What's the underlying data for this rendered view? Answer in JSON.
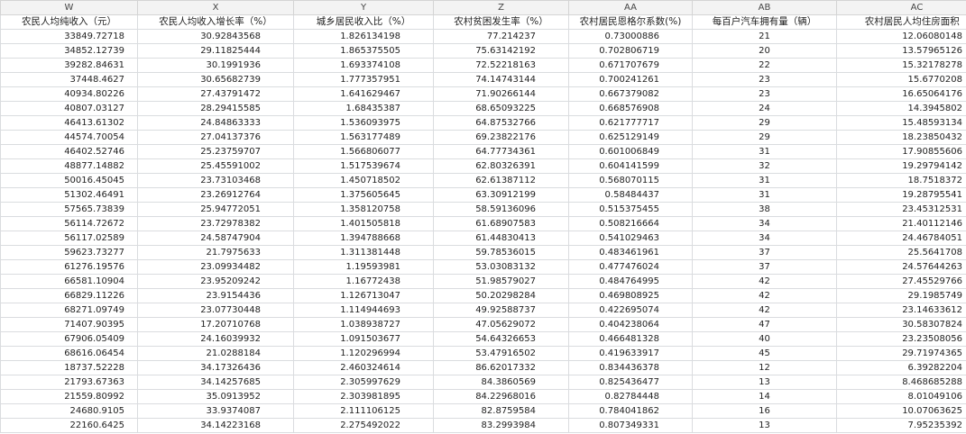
{
  "sheet": {
    "column_letters": [
      "W",
      "X",
      "Y",
      "Z",
      "AA",
      "AB",
      "AC"
    ],
    "headers": [
      "农民人均纯收入（元）",
      "农民人均收入增长率（%）",
      "城乡居民收入比（%）",
      "农村贫困发生率（%）",
      "农村居民恩格尔系数(%)",
      "每百户汽车拥有量（辆）",
      "农村居民人均住房面积（"
    ],
    "rows": [
      [
        "33849.72718",
        "30.92843568",
        "1.826134198",
        "77.214237",
        "0.73000886",
        "21",
        "12.06080148"
      ],
      [
        "34852.12739",
        "29.11825444",
        "1.865375505",
        "75.63142192",
        "0.702806719",
        "20",
        "13.57965126"
      ],
      [
        "39282.84631",
        "30.1991936",
        "1.693374108",
        "72.52218163",
        "0.671707679",
        "22",
        "15.32178278"
      ],
      [
        "37448.4627",
        "30.65682739",
        "1.777357951",
        "74.14743144",
        "0.700241261",
        "23",
        "15.6770208"
      ],
      [
        "40934.80226",
        "27.43791472",
        "1.641629467",
        "71.90266144",
        "0.667379082",
        "23",
        "16.65064176"
      ],
      [
        "40807.03127",
        "28.29415585",
        "1.68435387",
        "68.65093225",
        "0.668576908",
        "24",
        "14.3945802"
      ],
      [
        "46413.61302",
        "24.84863333",
        "1.536093975",
        "64.87532766",
        "0.621777717",
        "29",
        "15.48593134"
      ],
      [
        "44574.70054",
        "27.04137376",
        "1.563177489",
        "69.23822176",
        "0.625129149",
        "29",
        "18.23850432"
      ],
      [
        "46402.52746",
        "25.23759707",
        "1.566806077",
        "64.77734361",
        "0.601006849",
        "31",
        "17.90855606"
      ],
      [
        "48877.14882",
        "25.45591002",
        "1.517539674",
        "62.80326391",
        "0.604141599",
        "32",
        "19.29794142"
      ],
      [
        "50016.45045",
        "23.73103468",
        "1.450718502",
        "62.61387112",
        "0.568070115",
        "31",
        "18.7518372"
      ],
      [
        "51302.46491",
        "23.26912764",
        "1.375605645",
        "63.30912199",
        "0.58484437",
        "31",
        "19.28795541"
      ],
      [
        "57565.73839",
        "25.94772051",
        "1.358120758",
        "58.59136096",
        "0.515375455",
        "38",
        "23.45312531"
      ],
      [
        "56114.72672",
        "23.72978382",
        "1.401505818",
        "61.68907583",
        "0.508216664",
        "34",
        "21.40112146"
      ],
      [
        "56117.02589",
        "24.58747904",
        "1.394788668",
        "61.44830413",
        "0.541029463",
        "34",
        "24.46784051"
      ],
      [
        "59623.73277",
        "21.7975633",
        "1.311381448",
        "59.78536015",
        "0.483461961",
        "37",
        "25.5641708"
      ],
      [
        "61276.19576",
        "23.09934482",
        "1.19593981",
        "53.03083132",
        "0.477476024",
        "37",
        "24.57644263"
      ],
      [
        "66581.10904",
        "23.95209242",
        "1.16772438",
        "51.98579027",
        "0.484764995",
        "42",
        "27.45529766"
      ],
      [
        "66829.11226",
        "23.9154436",
        "1.126713047",
        "50.20298284",
        "0.469808925",
        "42",
        "29.1985749"
      ],
      [
        "68271.09749",
        "23.07730448",
        "1.114944693",
        "49.92588737",
        "0.422695074",
        "42",
        "23.14633612"
      ],
      [
        "71407.90395",
        "17.20710768",
        "1.038938727",
        "47.05629072",
        "0.404238064",
        "47",
        "30.58307824"
      ],
      [
        "67906.05409",
        "24.16039932",
        "1.091503677",
        "54.64326653",
        "0.466481328",
        "40",
        "23.23508056"
      ],
      [
        "68616.06454",
        "21.0288184",
        "1.120296994",
        "53.47916502",
        "0.419633917",
        "45",
        "29.71974365"
      ],
      [
        "18737.52228",
        "34.17326436",
        "2.460324614",
        "86.62017332",
        "0.834436378",
        "12",
        "6.39282204"
      ],
      [
        "21793.67363",
        "34.14257685",
        "2.305997629",
        "84.3860569",
        "0.825436477",
        "13",
        "8.468685288"
      ],
      [
        "21559.80992",
        "35.0913952",
        "2.303981895",
        "84.22968016",
        "0.82784448",
        "14",
        "8.01049106"
      ],
      [
        "24680.9105",
        "33.9374087",
        "2.111106125",
        "82.8759584",
        "0.784041862",
        "16",
        "10.07063625"
      ],
      [
        "22160.6425",
        "34.14223168",
        "2.275492022",
        "83.2993984",
        "0.807349331",
        "13",
        "7.95235392"
      ]
    ]
  }
}
